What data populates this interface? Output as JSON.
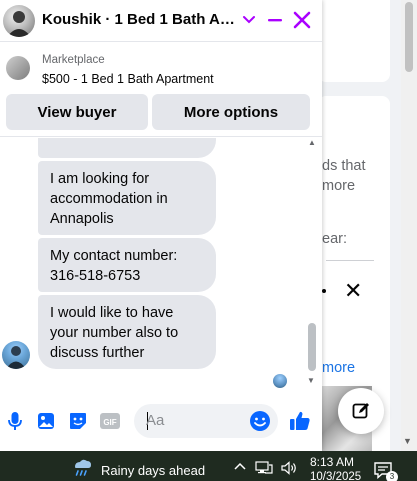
{
  "chat": {
    "title": "Koushik · 1 Bed 1 Bath Apa...",
    "listing": {
      "kicker": "Marketplace",
      "title": "$500 - 1 Bed 1 Bath Apartment",
      "view_buyer_label": "View buyer",
      "more_options_label": "More options"
    },
    "messages": [
      {
        "text": "I am looking for accommodation in Annapolis"
      },
      {
        "text": "My contact number: 316-518-6753"
      },
      {
        "text": "I would like to have your number also to discuss further"
      }
    ],
    "composer": {
      "placeholder": "Aa",
      "icons": [
        "microphone-icon",
        "photo-icon",
        "sticker-icon",
        "gif-icon",
        "emoji-icon",
        "thumbs-up-icon"
      ]
    }
  },
  "background": {
    "snippet_1": "ds that",
    "snippet_2": "more",
    "snippet_3": "ear:",
    "snippet_4": "more"
  },
  "taskbar": {
    "weather": "Rainy days ahead",
    "time": "8:13 AM",
    "date": "10/3/2025",
    "notification_count": "3"
  },
  "colors": {
    "accent": "#aa00ff",
    "messenger_blue": "#0866ff",
    "bubble_bg": "#e4e6eb",
    "taskbar_bg": "#1f2b20"
  }
}
